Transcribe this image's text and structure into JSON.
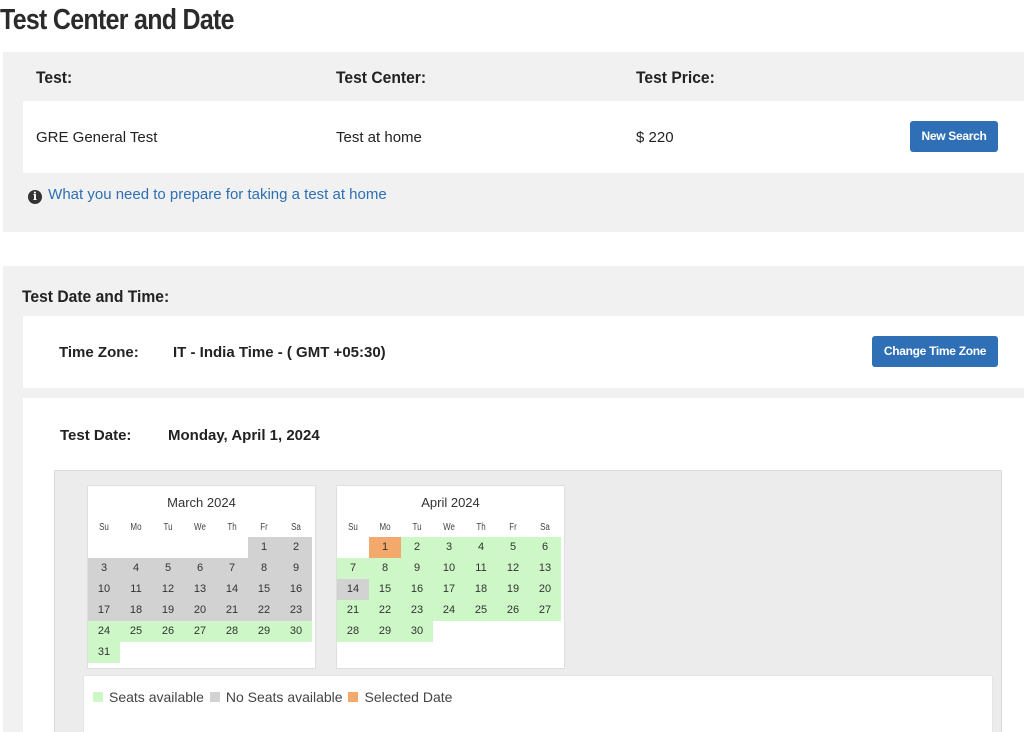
{
  "page_title": "Test Center and Date",
  "test_info": {
    "headers": {
      "test": "Test:",
      "center": "Test Center:",
      "price": "Test Price:"
    },
    "values": {
      "test": "GRE General Test",
      "center": "Test at home",
      "price": "$ 220"
    },
    "new_search_label": "New Search",
    "prepare_link": "What you need to prepare for taking a test at home"
  },
  "date_time": {
    "title": "Test Date and Time:",
    "time_zone_label": "Time Zone:",
    "time_zone_value": "IT - India Time - ( GMT +05:30)",
    "change_tz_label": "Change Time Zone",
    "test_date_label": "Test Date:",
    "test_date_value": "Monday, April 1, 2024"
  },
  "weekdays": [
    "Su",
    "Mo",
    "Tu",
    "We",
    "Th",
    "Fr",
    "Sa"
  ],
  "calendars": [
    {
      "title": "March 2024",
      "first_weekday": 5,
      "days_in_month": 31,
      "no_seats": [
        1,
        2,
        3,
        4,
        5,
        6,
        7,
        8,
        9,
        10,
        11,
        12,
        13,
        14,
        15,
        16,
        17,
        18,
        19,
        20,
        21,
        22,
        23
      ],
      "selected": []
    },
    {
      "title": "April 2024",
      "first_weekday": 1,
      "days_in_month": 30,
      "no_seats": [
        14
      ],
      "selected": [
        1
      ]
    }
  ],
  "legend": {
    "available": "Seats available",
    "no_seats": "No Seats available",
    "selected": "Selected Date",
    "colors": {
      "available": "#cdf7c6",
      "no_seats": "#d2d2d2",
      "selected": "#f4a96c"
    }
  },
  "colors": {
    "accent": "#2e6fb5",
    "panel_bg": "#f1f1f1"
  }
}
